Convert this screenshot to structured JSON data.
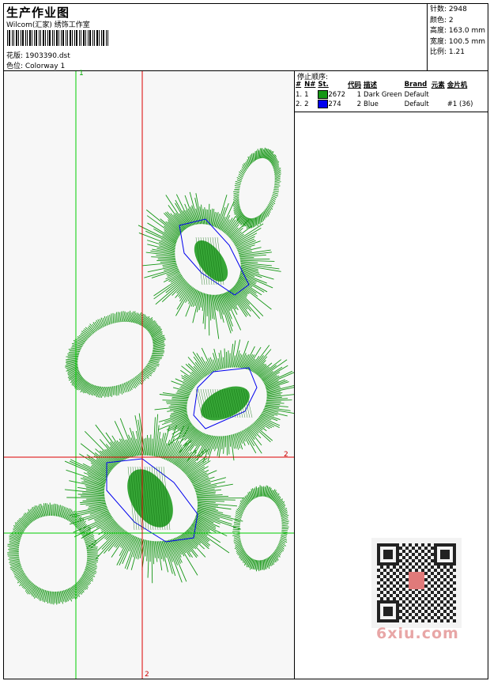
{
  "header": {
    "title": "生产作业图",
    "studio": "Wilcom(汇家) 绣饰工作室",
    "design_line": "花版:  1903390.dst",
    "colorway_line": "色位:  Colorway 1"
  },
  "stats": {
    "stitches": "针数: 2948",
    "colors": "颜色: 2",
    "height": "高度: 163.0 mm",
    "width": "宽度: 100.5 mm",
    "scale": "比例: 1.21"
  },
  "stop_sequence": {
    "title": "停止顺序:",
    "headers": [
      "#",
      "N#",
      "St.",
      "代码",
      "描述",
      "Brand",
      "元素",
      "金片机"
    ],
    "rows": [
      {
        "num": "1.",
        "needle": "1",
        "color": "#149614",
        "stitches": "2672",
        "code": "1",
        "desc": "Dark Green",
        "brand": "Default",
        "element": "",
        "seq": ""
      },
      {
        "num": "2.",
        "needle": "2",
        "color": "#0000ee",
        "stitches": "274",
        "code": "2",
        "desc": "Blue",
        "brand": "Default",
        "element": "",
        "seq": "#1 (36)"
      }
    ]
  },
  "axis_labels": {
    "green_top": "1",
    "red_h": "2",
    "red_v_bottom": "2"
  },
  "watermark": "6xiu.com",
  "colors": {
    "thread_green": "#149614",
    "thread_blue": "#0000ee",
    "guide_green": "#00cc00",
    "guide_red": "#dd0000"
  }
}
